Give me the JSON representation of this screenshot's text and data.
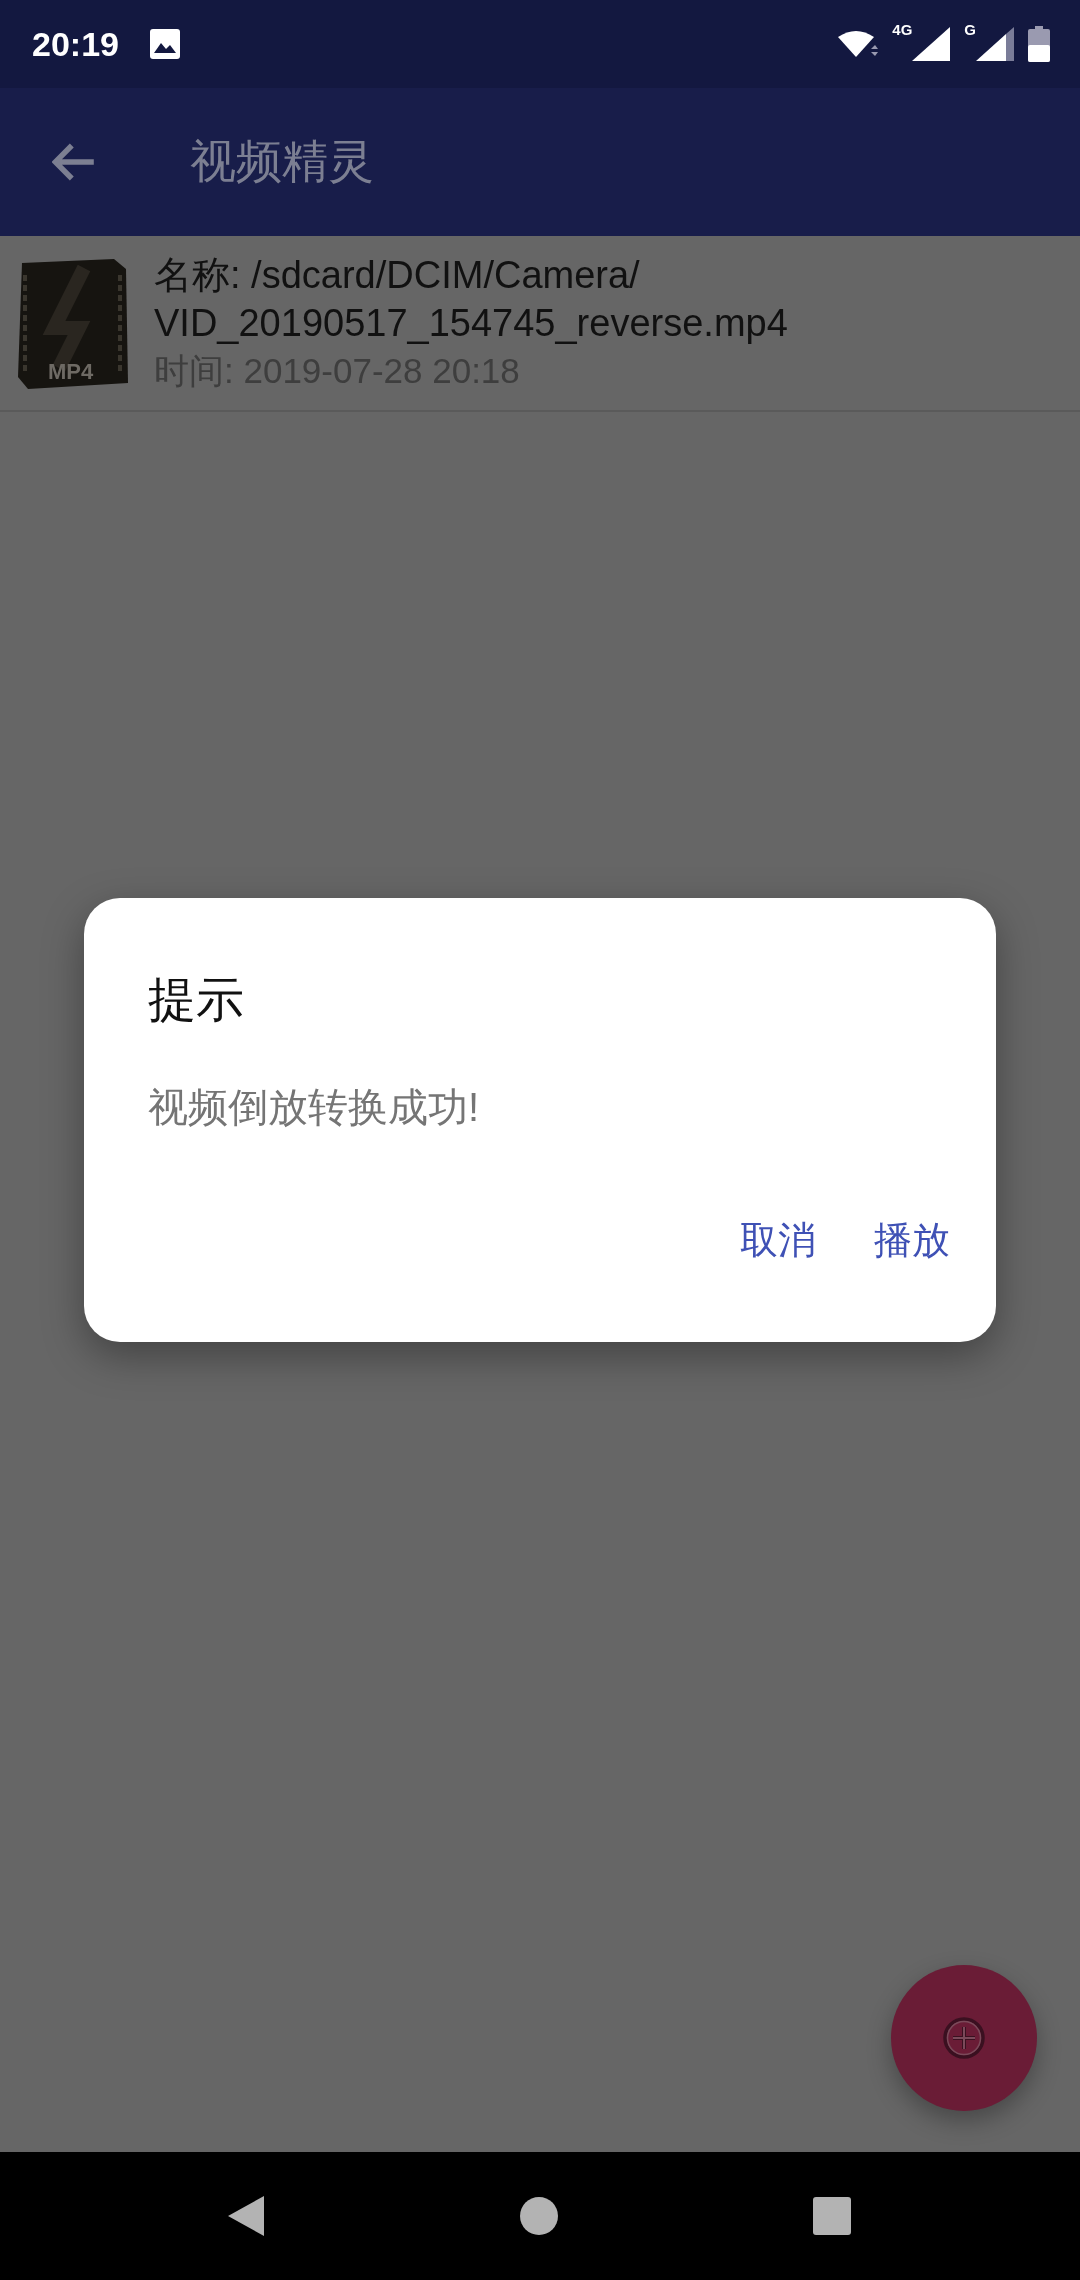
{
  "status_bar": {
    "time": "20:19",
    "network_labels": [
      "4G",
      "G"
    ]
  },
  "app_bar": {
    "title": "视频精灵"
  },
  "videos": [
    {
      "thumbnail_label": "MP4",
      "name_lines": [
        "名称: /sdcard/DCIM/Camera/",
        "VID_20190517_154745_reverse.mp4"
      ],
      "time": "时间: 2019-07-28 20:18"
    }
  ],
  "dialog": {
    "title": "提示",
    "message": "视频倒放转换成功!",
    "buttons": [
      "取消",
      "播放"
    ]
  }
}
